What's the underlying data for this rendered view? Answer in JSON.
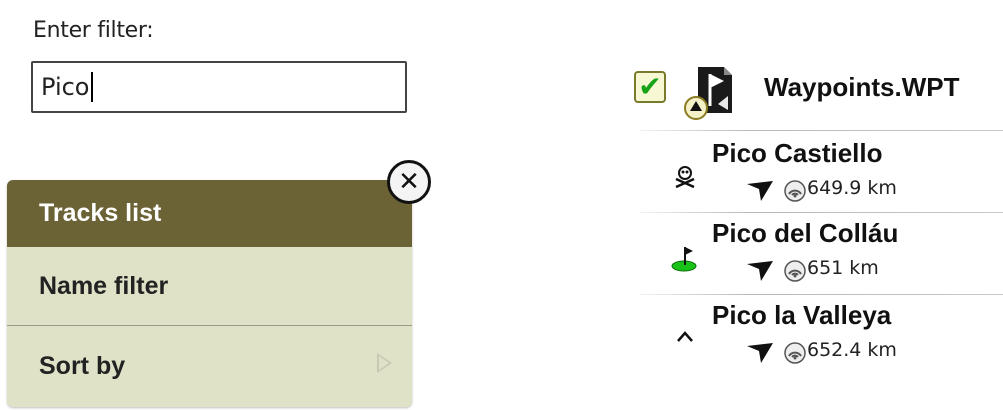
{
  "filter": {
    "label": "Enter filter:",
    "value": "Pico"
  },
  "menu": {
    "header": "Tracks list",
    "items": [
      {
        "label": "Name filter"
      },
      {
        "label": "Sort by"
      }
    ],
    "close_icon": "close-icon",
    "accent": "#6b6335",
    "background": "#dfe2c7"
  },
  "file": {
    "checked": true,
    "name": "Waypoints.WPT",
    "icon": "flag-file-icon"
  },
  "waypoints": [
    {
      "name": "Pico Castiello",
      "distance": "649.9 km",
      "icon": "skull-icon"
    },
    {
      "name": "Pico del Colláu",
      "distance": "651 km",
      "icon": "golf-flag-icon"
    },
    {
      "name": "Pico la Valleya",
      "distance": "652.4 km",
      "icon": "peak-icon"
    }
  ]
}
